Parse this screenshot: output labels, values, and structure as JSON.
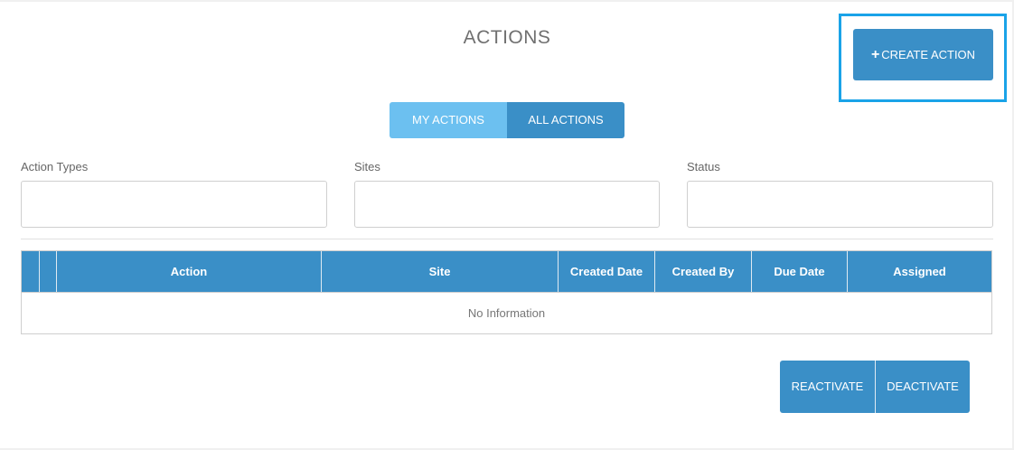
{
  "header": {
    "title": "ACTIONS"
  },
  "create_button": {
    "icon": "plus-icon",
    "label": "CREATE ACTION"
  },
  "view_toggle": {
    "my_actions": "MY ACTIONS",
    "all_actions": "ALL ACTIONS"
  },
  "filters": {
    "action_types": {
      "label": "Action Types",
      "value": ""
    },
    "sites": {
      "label": "Sites",
      "value": ""
    },
    "status": {
      "label": "Status",
      "value": ""
    }
  },
  "table": {
    "columns": [
      "",
      "",
      "Action",
      "Site",
      "Created Date",
      "Created By",
      "Due Date",
      "Assigned"
    ],
    "empty_text": "No Information"
  },
  "footer_buttons": {
    "reactivate": "REACTIVATE",
    "deactivate": "DEACTIVATE"
  },
  "colors": {
    "primary": "#3a8fc7",
    "toggle_active": "#6cc0f0",
    "highlight": "#1aa3e8"
  }
}
